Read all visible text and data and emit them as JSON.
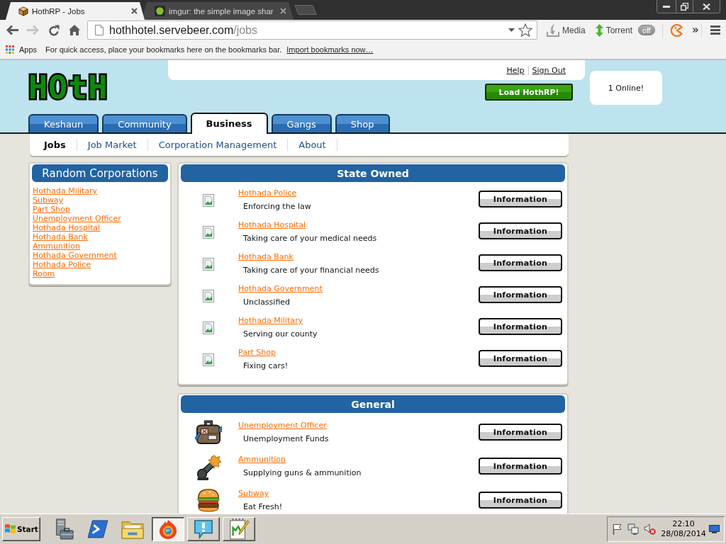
{
  "browser": {
    "tabs": [
      {
        "title": "HothRP - Jobs",
        "selected": true
      },
      {
        "title": "imgur: the simple image shar",
        "selected": false
      }
    ],
    "nav_buttons": [
      {
        "kind": "back",
        "disabled": false
      },
      {
        "kind": "forward",
        "disabled": true
      },
      {
        "kind": "reload",
        "disabled": false
      },
      {
        "kind": "home",
        "disabled": false
      }
    ],
    "address": {
      "host": "hothhotel.servebeer.com",
      "path": "/jobs"
    },
    "toolbar_buttons": [
      {
        "label": "Media"
      },
      {
        "label": "Torrent",
        "toggle": "off",
        "on": false
      }
    ],
    "bookmarks_bar": {
      "apps": "Apps",
      "hint": "For quick access, place your bookmarks here on the bookmarks bar.",
      "import_link": "Import bookmarks now…"
    }
  },
  "site": {
    "logo": "HOtH",
    "links": [
      "Help",
      "Sign Out"
    ],
    "load_button": "Load HothRP!",
    "online": "1 Online!"
  },
  "nav_tabs": [
    {
      "label": "Keshaun",
      "selected": false
    },
    {
      "label": "Community",
      "selected": false
    },
    {
      "label": "Business",
      "selected": true
    },
    {
      "label": "Gangs",
      "selected": false
    },
    {
      "label": "Shop",
      "selected": false
    }
  ],
  "sub_nav": [
    {
      "label": "Jobs",
      "selected": true
    },
    {
      "label": "Job Market",
      "selected": false
    },
    {
      "label": "Corporation Management",
      "selected": false
    },
    {
      "label": "About",
      "selected": false
    }
  ],
  "random_corporations": {
    "title": "Random Corporations",
    "links": [
      "Hothada Military",
      "Subway",
      "Part Shop",
      "Unemployment Officer",
      "Hothada Hospital",
      "Hothada Bank",
      "Ammunition",
      "Hothada Government",
      "Hothada Police",
      "Room"
    ]
  },
  "sections": [
    {
      "title": "State Owned",
      "rows": [
        {
          "kind": "missing-image",
          "name": "Hothada Police",
          "description": "Enforcing the law",
          "button": "Information"
        },
        {
          "kind": "missing-image",
          "name": "Hothada Hospital",
          "description": "Taking care of your medical needs",
          "button": "Information"
        },
        {
          "kind": "missing-image",
          "name": "Hothada Bank",
          "description": "Taking care of your financial needs",
          "button": "Information"
        },
        {
          "kind": "missing-image",
          "name": "Hothada Government",
          "description": "Unclassified",
          "button": "Information"
        },
        {
          "kind": "missing-image",
          "name": "Hothada Military",
          "description": "Serving our county",
          "button": "Information"
        },
        {
          "kind": "missing-image",
          "name": "Part Shop",
          "description": "Fixing cars!",
          "button": "Information"
        }
      ]
    },
    {
      "title": "General",
      "rows": [
        {
          "kind": "image",
          "name": "Unemployment Officer",
          "description": "Unemployment Funds",
          "button": "Information"
        },
        {
          "kind": "image",
          "name": "Ammunition",
          "description": "Supplying guns & ammunition",
          "button": "Information"
        },
        {
          "kind": "image",
          "name": "Subway",
          "description": "Eat Fresh!",
          "button": "Information"
        }
      ]
    }
  ],
  "taskbar": {
    "start": "Start",
    "apps": [
      {
        "kind": "pinned",
        "selected": false
      },
      {
        "kind": "pinned",
        "selected": false
      },
      {
        "kind": "pinned",
        "selected": false
      },
      {
        "kind": "window",
        "selected": true
      },
      {
        "kind": "window",
        "selected": false
      },
      {
        "kind": "window",
        "selected": false
      }
    ],
    "clock": {
      "time": "22:10",
      "date": "28/08/2014"
    }
  }
}
